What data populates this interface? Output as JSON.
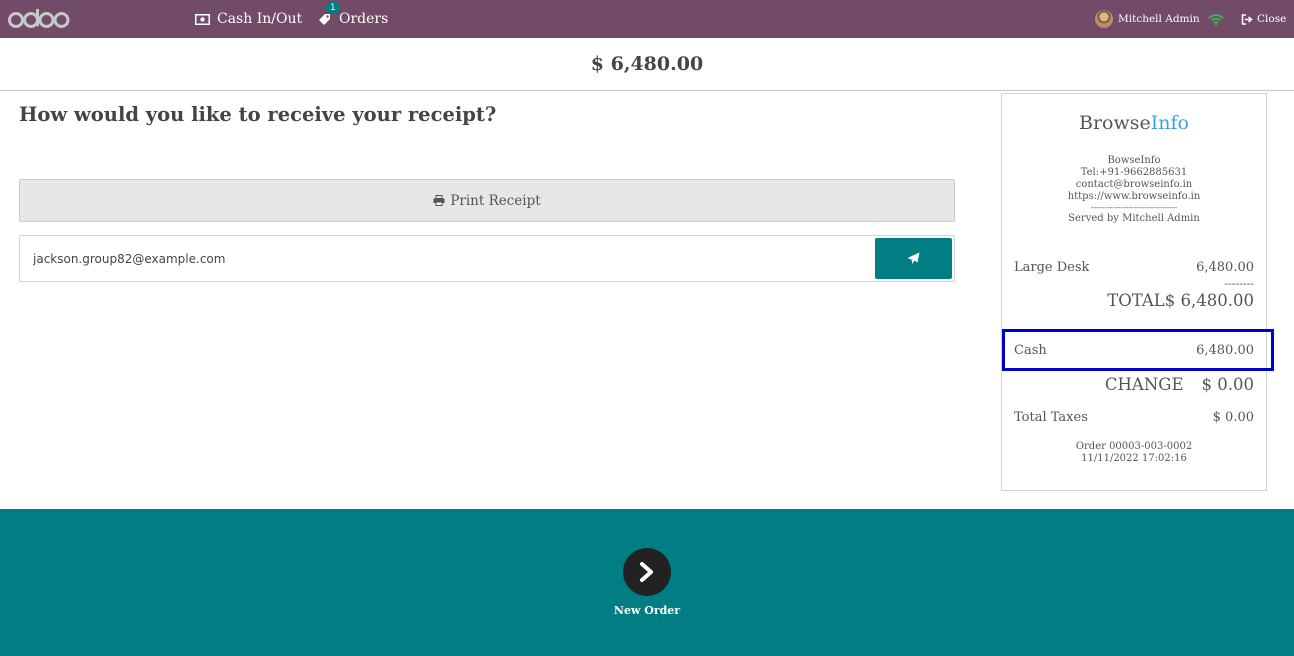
{
  "header": {
    "logo_text": "odoo",
    "nav": [
      {
        "label": "Cash In/Out",
        "icon": "money-icon"
      },
      {
        "label": "Orders",
        "icon": "tag-icon",
        "badge": "1"
      }
    ],
    "user_name": "Mitchell Admin",
    "close_label": "Close"
  },
  "total_amount": "$ 6,480.00",
  "receipt_options": {
    "question": "How would you like to receive your receipt?",
    "print_label": "Print Receipt",
    "email_value": "jackson.group82@example.com"
  },
  "receipt": {
    "brand_main": "Browse",
    "brand_accent": "Info",
    "company_name": "BowseInfo",
    "tel": "Tel:+91-9662885631",
    "email": "contact@browseinfo.in",
    "website": "https://www.browseinfo.in",
    "separator": "--------------------------------",
    "served_by": "Served by Mitchell Admin",
    "line_item": {
      "name": "Large Desk",
      "amount": "6,480.00"
    },
    "dashes": "--------",
    "total_label": "TOTAL",
    "total_value": "$ 6,480.00",
    "payment": {
      "method": "Cash",
      "amount": "6,480.00"
    },
    "change_label": "CHANGE",
    "change_value": "$ 0.00",
    "taxes_label": "Total Taxes",
    "taxes_value": "$ 0.00",
    "order_ref": "Order 00003-003-0002",
    "order_date": "11/11/2022 17:02:16"
  },
  "footer": {
    "next_label": "New Order"
  },
  "colors": {
    "topbar": "#714b67",
    "accent": "#017e84",
    "highlight": "#0000cc",
    "brand_accent": "#3aa3d9"
  }
}
